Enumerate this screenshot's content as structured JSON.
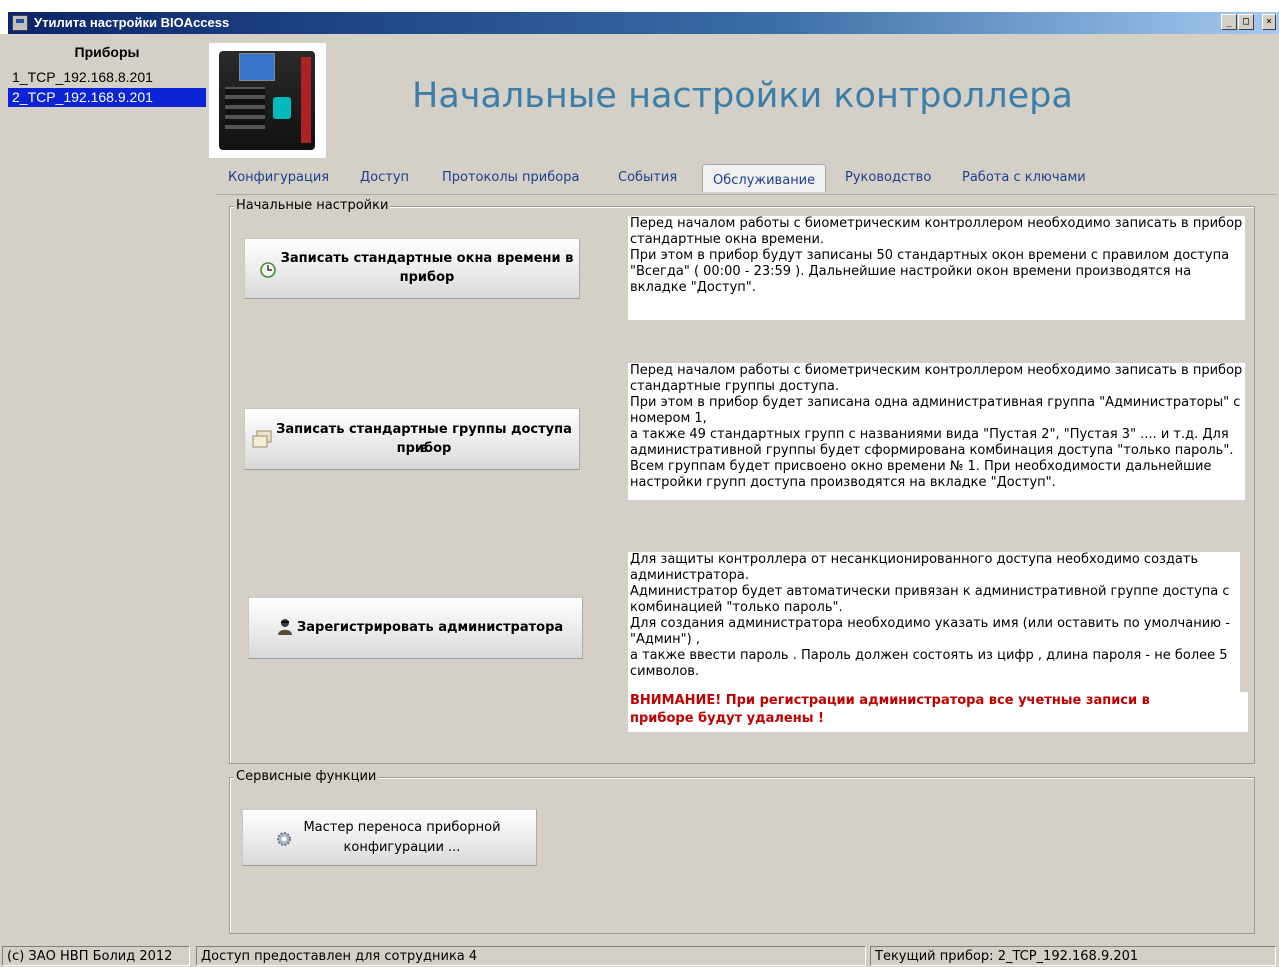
{
  "window": {
    "title": "Утилита настройки BIOAccess",
    "controls": [
      "_",
      "□",
      "×"
    ]
  },
  "devices": {
    "header": "Приборы",
    "items": [
      {
        "label": "1_TCP_192.168.8.201",
        "selected": false
      },
      {
        "label": "2_TCP_192.168.9.201",
        "selected": true
      }
    ]
  },
  "page_title": "Начальные настройки контроллера",
  "tabs": [
    {
      "label": "Конфигурация",
      "active": false
    },
    {
      "label": "Доступ",
      "active": false
    },
    {
      "label": "Протоколы прибора",
      "active": false
    },
    {
      "label": "События",
      "active": false
    },
    {
      "label": "Обслуживание",
      "active": true
    },
    {
      "label": "Руководство",
      "active": false
    },
    {
      "label": "Работа с ключами",
      "active": false
    }
  ],
  "initial_settings": {
    "legend": "Начальные настройки",
    "time_windows": {
      "button_line1": "Записать стандартные окна времени  в",
      "button_line2": "прибор",
      "icon": "clock-icon",
      "description": [
        "Перед началом работы с биометрическим контроллером необходимо записать в прибор",
        "стандартные окна времени.",
        "При этом в прибор будут записаны 50 стандартных окон времени с правилом доступа",
        "\"Всегда\"  ( 00:00 - 23:59 ). Дальнейшие настройки окон времени производятся на",
        "вкладке \"Доступ\"."
      ]
    },
    "access_groups": {
      "button_line1": "Записать стандартные группы доступа в",
      "button_line2": "прибор",
      "icon": "windows-icon",
      "description": [
        "Перед началом работы с биометрическим контроллером необходимо записать в прибор",
        "стандартные группы доступа.",
        "При этом в прибор будет записана одна административная группа \"Администраторы\" с",
        "номером 1,",
        " а также 49 стандартных групп с названиями вида \"Пустая 2\", \"Пустая 3\" .... и т.д. Для",
        "административной группы будет сформирована комбинация доступа \"только пароль\".",
        "Всем группам  будет присвоено окно времени № 1. При необходимости дальнейшие",
        "настройки групп доступа производятся на вкладке \"Доступ\"."
      ]
    },
    "register_admin": {
      "button_label": "Зарегистрировать администратора",
      "icon": "user-icon",
      "description": [
        "Для защиты контроллера от несанкционированного доступа необходимо создать",
        "администратора.",
        "Администратор  будет автоматически привязан к административной группе доступа с",
        "комбинацией \"только пароль\".",
        "Для создания администратора необходимо указать имя   (или оставить по умолчанию  -",
        "\"Админ\") ,",
        "а также ввести пароль . Пароль должен состоять из цифр , длина пароля - не более 5",
        "символов."
      ],
      "warning_line1": "ВНИМАНИЕ!  При регистрации администратора все учетные записи в",
      "warning_line2": "приборе будут удалены !"
    }
  },
  "service_functions": {
    "legend": "Сервисные функции",
    "wizard": {
      "button_line1": "Мастер переноса приборной",
      "button_line2": "конфигурации ...",
      "icon": "gear-icon"
    }
  },
  "status_bar": {
    "copyright": "(с) ЗАО НВП Болид 2012",
    "access": "Доступ предоставлен для сотрудника 4",
    "current_device": "Текущий прибор: 2_TCP_192.168.9.201"
  },
  "colors": {
    "title_text": "#3b7fa8",
    "tab_text": "#1e3f8a",
    "selected_bg": "#0a24d6",
    "warning": "#c00000"
  }
}
